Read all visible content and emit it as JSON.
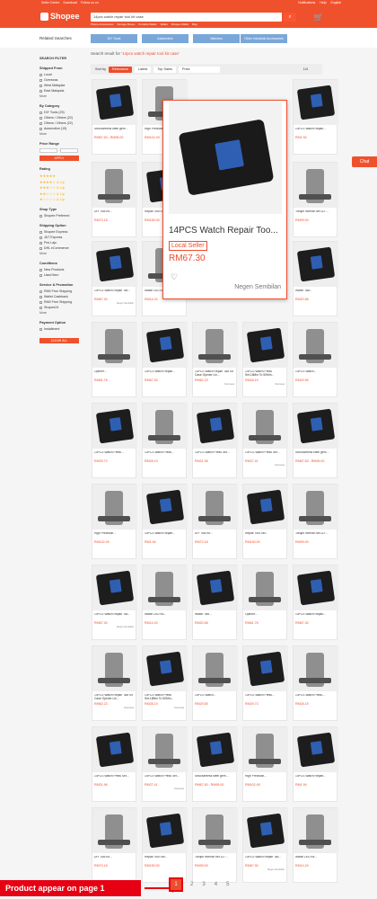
{
  "header": {
    "topbar_left": [
      "Seller Centre",
      "Download",
      "Follow us on"
    ],
    "topbar_right": [
      "Notifications",
      "Help",
      "English"
    ],
    "logo": "Shopee",
    "search_query": "14pcs watch repair tool kit case",
    "search_suggestions": [
      "Phone Accessories",
      "Storage Boxes",
      "Portable Wallet",
      "Wallet",
      "Shopee Wallet",
      "Bag"
    ]
  },
  "related": {
    "label": "Related Searches",
    "tags": [
      "DIY Tools",
      "Automotive",
      "Watches",
      "Other Industrial Accessories"
    ]
  },
  "sidebar": {
    "title": "SEARCH FILTER",
    "shipped_from": {
      "heading": "Shipped From",
      "items": [
        "Local",
        "Overseas",
        "West Malaysia",
        "East Malaysia"
      ],
      "more": "More"
    },
    "category": {
      "heading": "By Category",
      "items": [
        "DIY Tools (29)",
        "Others / Others (22)",
        "Others / Others (22)",
        "Automotive (19)"
      ],
      "more": "More"
    },
    "price": {
      "heading": "Price Range",
      "apply": "APPLY"
    },
    "rating": {
      "heading": "Rating",
      "rows": [
        "★★★★★",
        "★★★★☆ & Up",
        "★★★☆☆ & Up",
        "★★☆☆☆ & Up",
        "★☆☆☆☆ & Up"
      ]
    },
    "shop_type": {
      "heading": "Shop Type",
      "items": [
        "Shopee Preferred"
      ]
    },
    "shipping": {
      "heading": "Shipping Option",
      "items": [
        "Shopee Express",
        "J&T Express",
        "Pos Laju",
        "DHL eCommerce"
      ],
      "more": "More"
    },
    "conditions": {
      "heading": "Conditions",
      "items": [
        "New Products",
        "Used Item"
      ]
    },
    "service": {
      "heading": "Service & Promotion",
      "items": [
        "RM0 Free Shipping",
        "Wallet Cashback",
        "RM0 Free Shipping",
        "Shopee24"
      ],
      "more": "More"
    },
    "payment": {
      "heading": "Payment Option",
      "items": [
        "Installment"
      ]
    },
    "clear": "CLEAR ALL"
  },
  "search_note": {
    "prefix": "Search result for",
    "query": "'14pcs watch repair tool kit case'"
  },
  "sort": {
    "label": "Sort by",
    "options": [
      "Relevance",
      "Latest",
      "Top Sales"
    ],
    "price": "Price",
    "page": "1/4"
  },
  "products": [
    {
      "title": "Structureless steel gem ...",
      "price": "RM67.63 - RM95.00",
      "loc": ""
    },
    {
      "title": "High Precision...",
      "price": "RM102.49",
      "loc": ""
    },
    {
      "title": "14PCS Watch Repair...",
      "price": "RM1.94",
      "loc": ""
    },
    {
      "title": "DIY Tool Kit...",
      "price": "RM73.18",
      "loc": ""
    },
    {
      "title": "Repair Tool Set...",
      "price": "RM150.00",
      "loc": ""
    },
    {
      "title": "Torque Wrench set 1/2\"...",
      "price": "RM99.00",
      "loc": ""
    },
    {
      "title": "14PCS Watch Repair Too...",
      "price": "RM67.30",
      "loc": "Negen Sembilan",
      "highlight": true
    },
    {
      "title": "Watch LED Kit...",
      "price": "RM14.24",
      "loc": ""
    },
    {
      "title": "Watch Tool...",
      "price": "RM20.58",
      "loc": ""
    },
    {
      "title": "Opener...",
      "price": "RM81.76",
      "loc": ""
    },
    {
      "title": "14PCS Watch Repair...",
      "price": "RM67.30",
      "loc": ""
    },
    {
      "title": "14PCS Watch Repair Tool Kit Case Opener Lin...",
      "price": "RM62.23",
      "loc": "Overseas"
    },
    {
      "title": "14PCS Watch Press Set,18Mm To 50Mm...",
      "price": "RM28.19",
      "loc": "Overseas"
    },
    {
      "title": "14PCS Watch...",
      "price": "RM29.55",
      "loc": ""
    },
    {
      "title": "14PCS Watch Press...",
      "price": "RM29.73",
      "loc": ""
    },
    {
      "title": "14PCS Watch Press...",
      "price": "RM28.19",
      "loc": ""
    },
    {
      "title": "14PCS Watch Press Set...",
      "price": "RM31.96",
      "loc": ""
    },
    {
      "title": "14PCS Watch Press Set...",
      "price": "RM27.41",
      "loc": "Overseas"
    }
  ],
  "popup": {
    "title": "14PCS Watch Repair Too...",
    "seller": "Local Seller",
    "price": "RM67.30",
    "shop": "Negen Sembilan"
  },
  "chat": "Chat",
  "banner": "Product appear on page 1",
  "pagination": [
    "1",
    "2",
    "3",
    "4",
    "5"
  ]
}
